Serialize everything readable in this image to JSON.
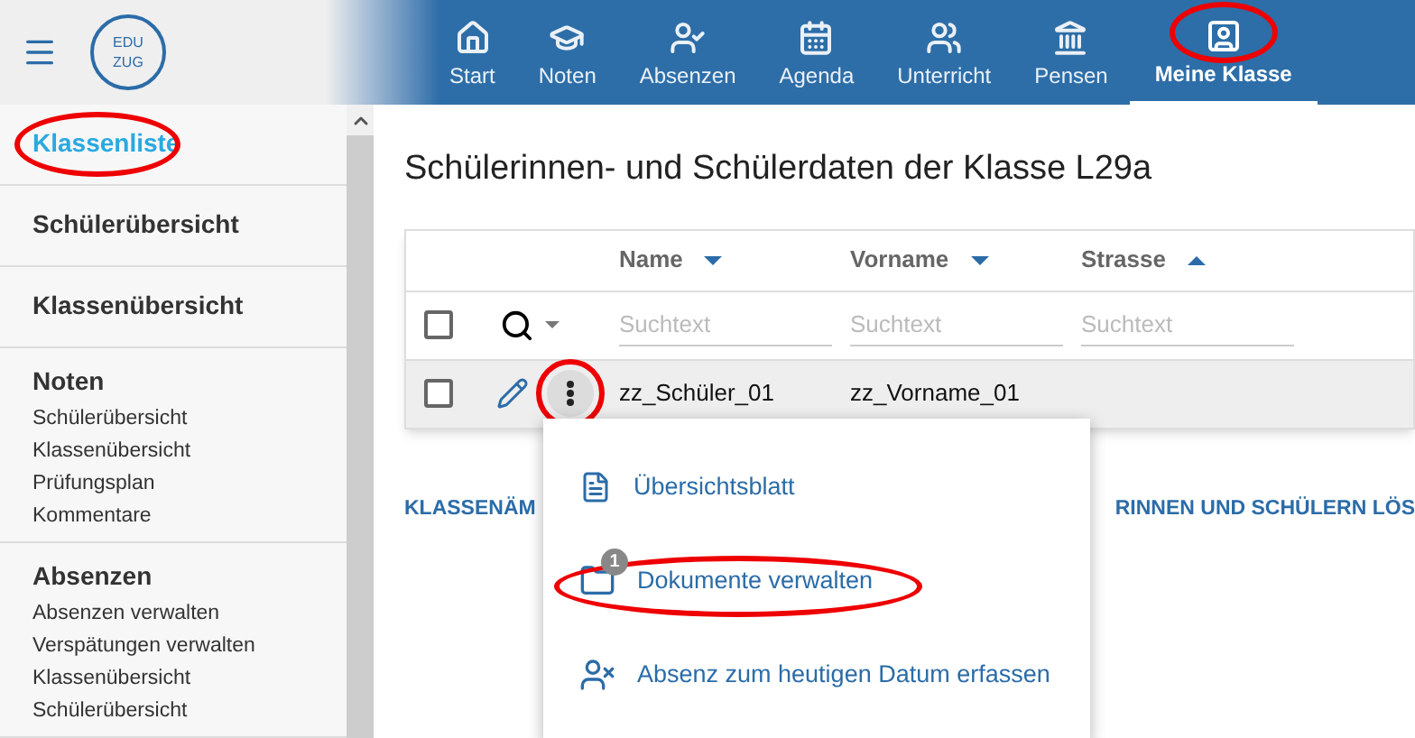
{
  "header": {
    "logo_lines": [
      "EDU",
      "ZUG"
    ]
  },
  "nav_tabs": [
    {
      "label": "Start",
      "selected": false,
      "circled": false
    },
    {
      "label": "Noten",
      "selected": false,
      "circled": false
    },
    {
      "label": "Absenzen",
      "selected": false,
      "circled": false
    },
    {
      "label": "Agenda",
      "selected": false,
      "circled": false
    },
    {
      "label": "Unterricht",
      "selected": false,
      "circled": false
    },
    {
      "label": "Pensen",
      "selected": false,
      "circled": false
    },
    {
      "label": "Meine Klasse",
      "selected": true,
      "circled": true
    }
  ],
  "sidebar": {
    "items": [
      {
        "kind": "link",
        "label": "Klassenliste",
        "selected": true,
        "circled": true
      },
      {
        "kind": "link",
        "label": "Schülerübersicht",
        "selected": false,
        "circled": false
      },
      {
        "kind": "link",
        "label": "Klassenübersicht",
        "selected": false,
        "circled": false
      },
      {
        "kind": "section",
        "title": "Noten",
        "children": [
          {
            "label": "Schülerübersicht",
            "selected": false
          },
          {
            "label": "Klassenübersicht",
            "selected": false
          },
          {
            "label": "Prüfungsplan",
            "selected": false
          },
          {
            "label": "Kommentare",
            "selected": false
          }
        ]
      },
      {
        "kind": "section",
        "title": "Absenzen",
        "children": [
          {
            "label": "Absenzen verwalten",
            "selected": false
          },
          {
            "label": "Verspätungen verwalten",
            "selected": false
          },
          {
            "label": "Klassenübersicht",
            "selected": false
          },
          {
            "label": "Schülerübersicht",
            "selected": false
          }
        ]
      }
    ]
  },
  "main": {
    "title": "Schülerinnen- und Schülerdaten der Klasse L29a",
    "table": {
      "select_all_checked": false,
      "columns": [
        {
          "label": "Name",
          "sort_ascending": false,
          "placeholder": "Suchtext"
        },
        {
          "label": "Vorname",
          "sort_ascending": false,
          "placeholder": "Suchtext"
        },
        {
          "label": "Strasse",
          "sort_ascending": true,
          "placeholder": "Suchtext"
        }
      ],
      "rows": [
        {
          "checked": false,
          "menu_circled": true,
          "cells": [
            "zz_Schüler_01",
            "zz_Vorname_01"
          ]
        }
      ]
    },
    "links": [
      "KLASSENÄM",
      "RINNEN UND SCHÜLERN LÖS"
    ],
    "context_menu": [
      {
        "kind": "sheet",
        "label": "Übersichtsblatt",
        "circled": false
      },
      {
        "kind": "folder",
        "label": "Dokumente verwalten",
        "badge": "1",
        "circled": true
      },
      {
        "kind": "absence",
        "label": "Absenz zum heutigen Datum erfassen",
        "circled": false
      }
    ]
  }
}
